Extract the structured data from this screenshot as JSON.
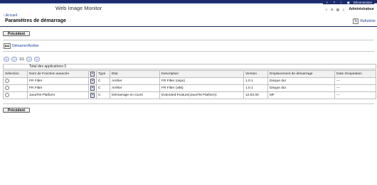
{
  "header": {
    "app_title": "Web Image Monitor",
    "logout_label": "Déconnexion",
    "user_name": "Administrateur",
    "top_icons": [
      "search-icon",
      "help-icon",
      "info-icon"
    ],
    "user_icons": [
      "user-icon",
      "settings-icon",
      "grid-icon"
    ]
  },
  "nav": {
    "home_link": "Accueil"
  },
  "page": {
    "title": "Paramètres de démarrage",
    "refresh_label": "Rafraîchir",
    "back_button_top": "Précédent",
    "back_button_bottom": "Précédent",
    "start_stop_label": "Démarrer/Arrêter"
  },
  "pager": {
    "page_info": "1/1"
  },
  "summary": {
    "total_label": "Total des applications:3"
  },
  "table": {
    "columns": [
      "Sélection",
      "Nom de Fonction avancée",
      "",
      "Type",
      "État",
      "Description",
      "Version",
      "Emplacement de démarrage",
      "Date d'expiration"
    ],
    "rows": [
      {
        "name": "FR Filter",
        "type": "C",
        "state": "Arrêter",
        "description": "FR Filter (mips)",
        "version": "1.0.1",
        "location": "Disque dur",
        "expiry": "---"
      },
      {
        "name": "FR Filter",
        "type": "C",
        "state": "Arrêter",
        "description": "FR Filter (x86)",
        "version": "1.0.1",
        "location": "Disque dur",
        "expiry": "---"
      },
      {
        "name": "JavaTM Platform",
        "type": "C",
        "state": "Démarrage en cours",
        "description": "Extended Feature(JavaTM Platform)",
        "version": "12.63.00",
        "location": "MF",
        "expiry": "---"
      }
    ]
  },
  "colors": {
    "header_band": "#1b2b6b",
    "link": "#1b3f94"
  }
}
